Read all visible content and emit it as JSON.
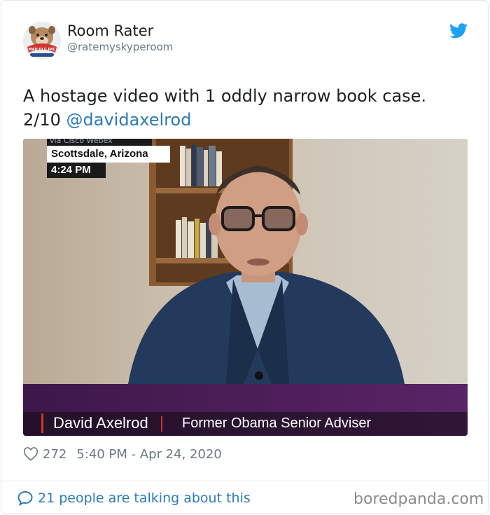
{
  "user": {
    "name": "Room Rater",
    "handle": "@ratemyskyperoom",
    "avatar_badge": "MAD DLG PAC"
  },
  "tweet": {
    "text_line1": "A hostage video with 1 oddly narrow book case.",
    "text_line2_prefix": "2/10 ",
    "mention": "@davidaxelrod"
  },
  "media": {
    "via": "via Cisco Webex",
    "location": "Scottsdale, Arizona",
    "time": "4:24 PM",
    "lower_third_name": "David Axelrod",
    "lower_third_title": "Former Obama Senior Adviser"
  },
  "meta": {
    "likes": "272",
    "timestamp": "5:40 PM - Apr 24, 2020"
  },
  "footer": {
    "talking": "21 people are talking about this",
    "watermark": "boredpanda.com"
  },
  "colors": {
    "link": "#2b7bb9",
    "twitter": "#1da1f2",
    "muted": "#697882",
    "lower_third": "#4a1d57"
  },
  "icons": [
    "twitter-bird-icon",
    "heart-icon",
    "speech-bubble-icon"
  ]
}
